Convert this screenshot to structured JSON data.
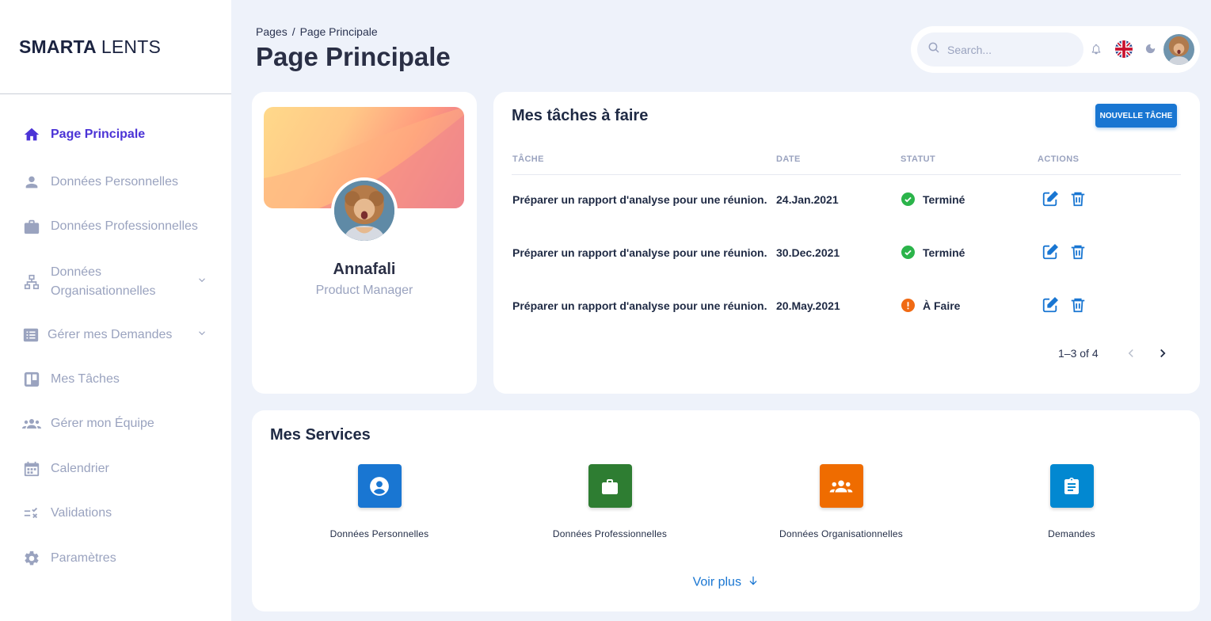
{
  "brand": {
    "bold": "SMARTA",
    "light": "LENTS"
  },
  "sidebar": {
    "items": [
      {
        "label": "Page Principale",
        "icon": "home-icon",
        "active": true
      },
      {
        "label": "Données Personnelles",
        "icon": "person-icon"
      },
      {
        "label": "Données Professionnelles",
        "icon": "briefcase-icon"
      },
      {
        "label": "Données Organisationnelles",
        "icon": "org-chart-icon",
        "expandable": true
      },
      {
        "label": "Gérer mes Demandes",
        "icon": "list-icon",
        "expandable": true
      },
      {
        "label": "Mes Tâches",
        "icon": "board-icon"
      },
      {
        "label": "Gérer mon Équipe",
        "icon": "team-icon"
      },
      {
        "label": "Calendrier",
        "icon": "calendar-icon"
      },
      {
        "label": "Validations",
        "icon": "checklist-icon"
      },
      {
        "label": "Paramètres",
        "icon": "gear-icon"
      }
    ],
    "org_line1": "Données",
    "org_line2": "Organisationnelles"
  },
  "header": {
    "breadcrumb": {
      "root": "Pages",
      "separator": "/",
      "current": "Page Principale"
    },
    "title": "Page Principale",
    "search_placeholder": "Search..."
  },
  "profile": {
    "name": "Annafali",
    "role": "Product Manager"
  },
  "tasks": {
    "title": "Mes tâches à faire",
    "new_task_label": "NOUVELLE TÂCHE",
    "columns": {
      "task": "TÂCHE",
      "date": "DATE",
      "status": "STATUT",
      "actions": "ACTIONS"
    },
    "rows": [
      {
        "task": "Préparer un rapport d'analyse pour une réunion.",
        "date": "24.Jan.2021",
        "status": "Terminé",
        "status_color": "#2bb44a"
      },
      {
        "task": "Préparer un rapport d'analyse pour une réunion.",
        "date": "30.Dec.2021",
        "status": "Terminé",
        "status_color": "#2bb44a"
      },
      {
        "task": "Préparer un rapport d'analyse pour une réunion.",
        "date": "20.May.2021",
        "status": "À Faire",
        "status_color": "#f06a14"
      }
    ],
    "pagination": "1–3 of 4"
  },
  "services": {
    "title": "Mes Services",
    "items": [
      {
        "label": "Données Personnelles",
        "icon": "account-circle-icon",
        "color": "#1976d2"
      },
      {
        "label": "Données Professionnelles",
        "icon": "briefcase-icon",
        "color": "#2e7d32"
      },
      {
        "label": "Données Organisationnelles",
        "icon": "groups-icon",
        "color": "#ef6c00"
      },
      {
        "label": "Demandes",
        "icon": "clipboard-icon",
        "color": "#0288d1"
      }
    ],
    "see_more": "Voir plus"
  },
  "colors": {
    "accent": "#4b33d6",
    "primary": "#1976d2",
    "muted": "#9aa3bf",
    "background": "#eef2fa"
  }
}
